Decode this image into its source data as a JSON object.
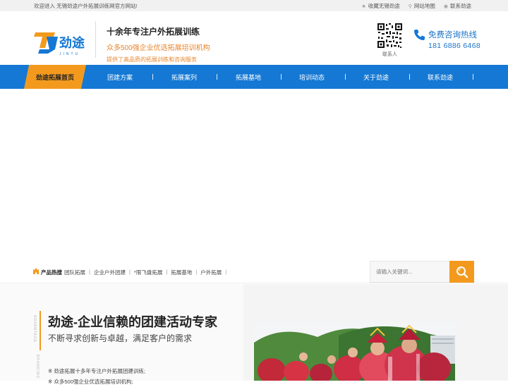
{
  "topbar": {
    "welcome": "欢迎进入 无锡劲途户外拓展训练网官方网站!",
    "links": [
      {
        "icon": "star-icon",
        "label": "收藏无锡劲途"
      },
      {
        "icon": "map-pin-icon",
        "label": "网站地图"
      },
      {
        "icon": "eye-icon",
        "label": "联系劲途"
      }
    ]
  },
  "header": {
    "logo_text": "劲途",
    "logo_sub": "JINTU",
    "slogan_title": "十余年专注户外拓展训练",
    "slogan_orange": "众多500强企业优选拓展培训机构",
    "slogan_small": "提供了高品质的拓展训练和咨询服务",
    "qr_label": "联系人",
    "hotline_title": "免费咨询热线",
    "hotline_number": "181 6886 6468",
    "brand_blue": "#1478d4",
    "brand_orange": "#f39a1e"
  },
  "nav": {
    "home": "劲途拓展首页",
    "items": [
      "团建方案",
      "拓展案列",
      "拓展基地",
      "培训动态",
      "关于劲途",
      "联系劲途"
    ]
  },
  "hot": {
    "label": "产品热搜",
    "links": [
      "团队拓展",
      "企业户外团建",
      "*限飞盘拓展",
      "拓展基地",
      "户外拓展"
    ],
    "search_placeholder": "请输入关键词..."
  },
  "intro": {
    "vertical_text_1": "ADVANTAGE",
    "vertical_text_2": "BRANDING",
    "title": "劲途-企业信赖的团建活动专家",
    "subtitle": "不断寻求创新与卓越，满足客户的需求",
    "points": [
      "※  劲途拓展十多年专注户外拓展团建训练;",
      "※  众多500强企业优选拓展培训机构;"
    ]
  }
}
